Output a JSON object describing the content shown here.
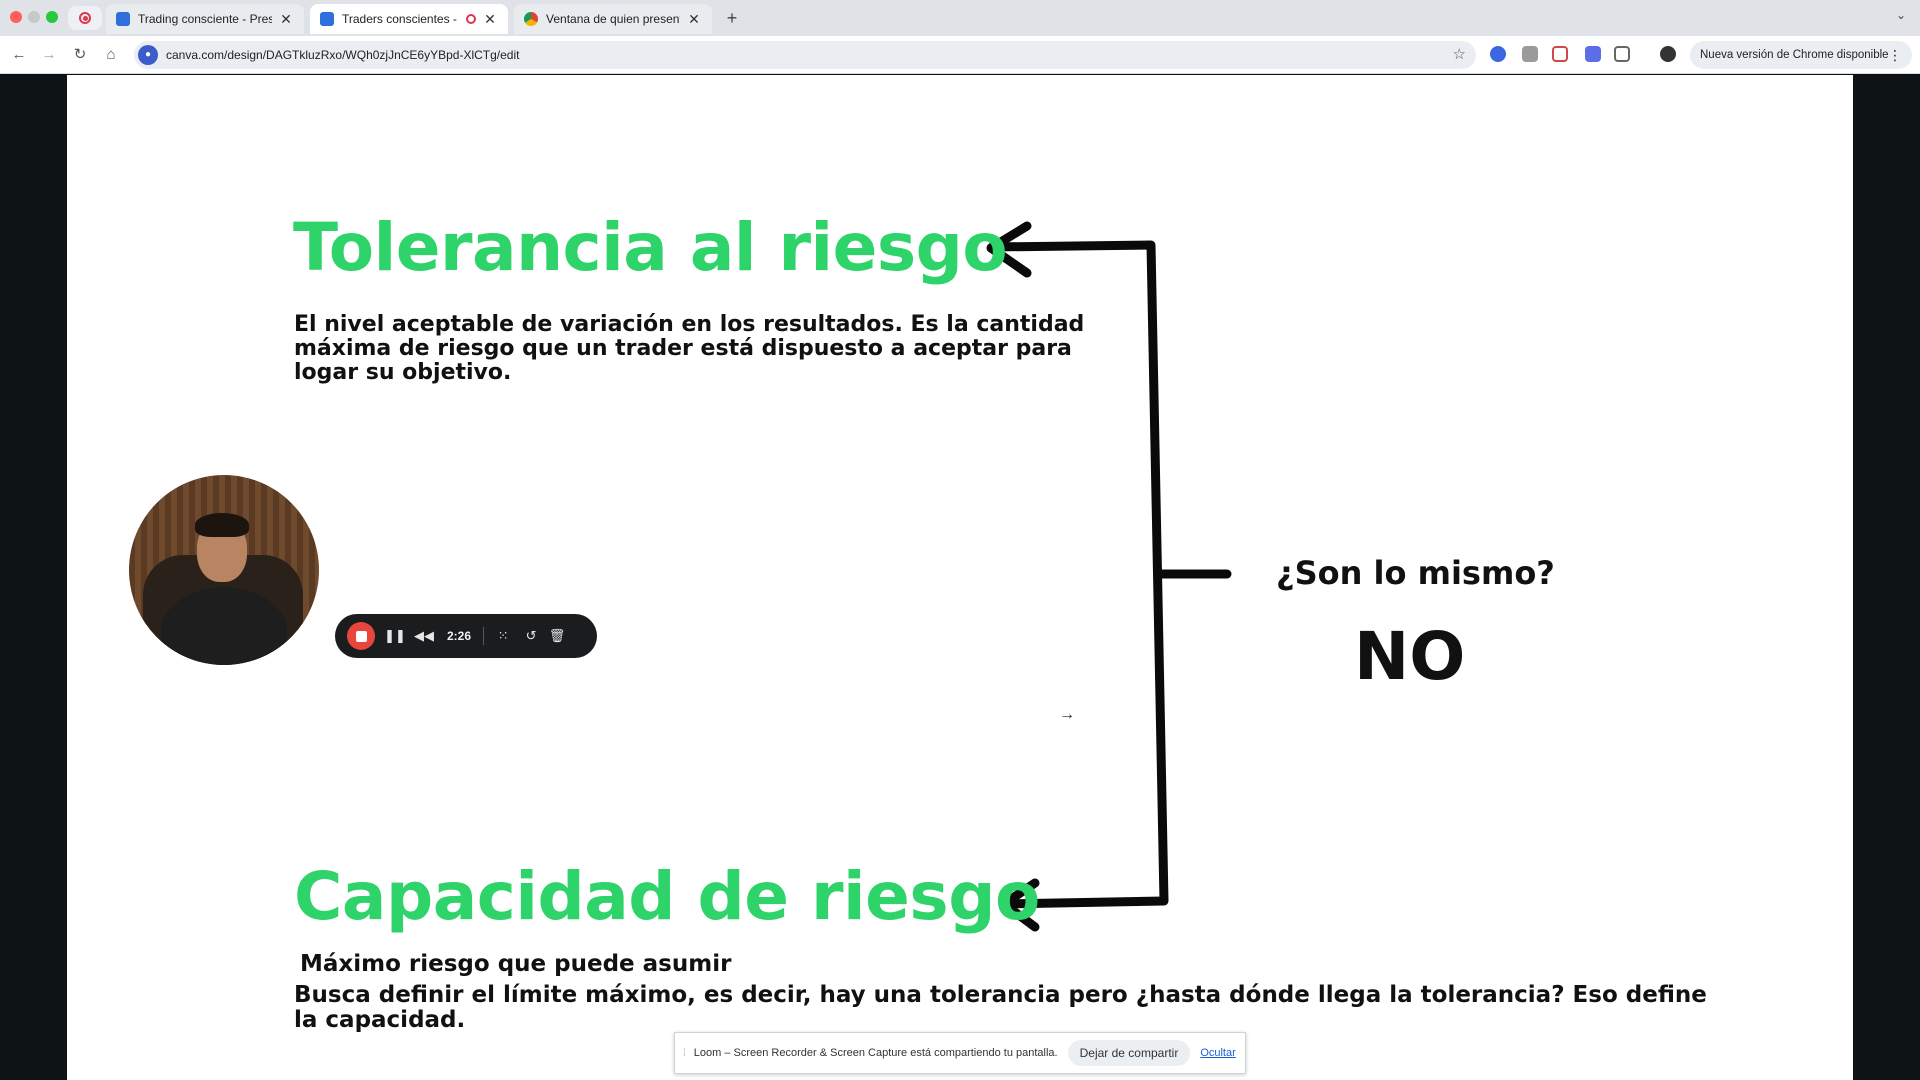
{
  "browser": {
    "tabs": [
      {
        "title": "Trading consciente - Presentación",
        "active": false
      },
      {
        "title": "Traders conscientes - Presentación",
        "active": true
      },
      {
        "title": "Ventana de quien presenta - Traders",
        "active": false
      }
    ],
    "new_tab_label": "+",
    "url": "canva.com/design/DAGTkluzRxo/WQh0zjJnCE6yYBpd-XlCTg/edit",
    "update_chip": "Nueva versión de Chrome disponible"
  },
  "slide": {
    "title_tolerancia": "Tolerancia al riesgo",
    "desc_tolerancia": "El nivel aceptable de variación en los resultados. Es la cantidad máxima de riesgo que un trader está dispuesto a aceptar para logar su objetivo.",
    "question": "¿Son lo mismo?",
    "answer": "NO",
    "title_capacidad": "Capacidad de riesgo",
    "subtitle_capacidad": "Máximo riesgo que puede asumir",
    "desc_capacidad": "Busca definir el límite máximo, es decir, hay una tolerancia pero ¿hasta dónde llega la tolerancia? Eso define la capacidad."
  },
  "loom": {
    "timer": "2:26",
    "share_notice": "Loom – Screen Recorder & Screen Capture está compartiendo tu pantalla.",
    "stop_sharing": "Dejar de compartir",
    "hide": "Ocultar"
  },
  "colors": {
    "accent_green": "#2ed36a",
    "text_dark": "#111111",
    "record_red": "#e8453c"
  }
}
